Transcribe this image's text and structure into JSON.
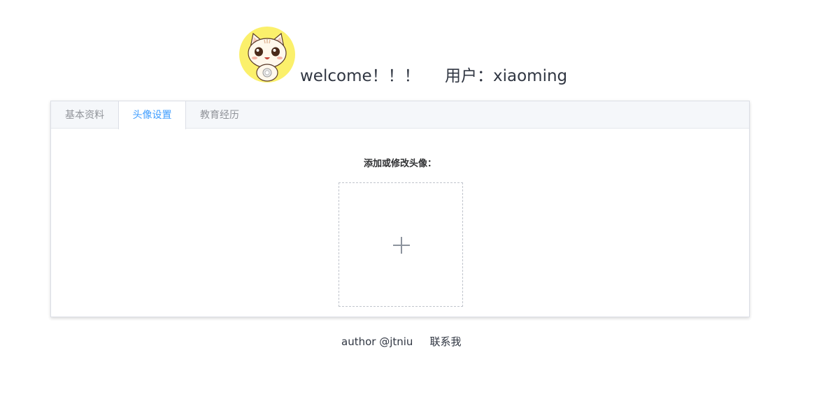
{
  "header": {
    "avatar_icon": "cat-avatar-icon",
    "welcome_text": "welcome！！！",
    "user_text": "用户：xiaoming"
  },
  "tabs": [
    {
      "label": "基本资料",
      "active": false
    },
    {
      "label": "头像设置",
      "active": true
    },
    {
      "label": "教育经历",
      "active": false
    }
  ],
  "avatar_settings": {
    "section_label": "添加或修改头像：",
    "upload_icon": "plus-icon"
  },
  "footer": {
    "author": "author @jtniu",
    "contact": "联系我"
  },
  "colors": {
    "accent": "#409eff",
    "avatar_bg": "#fbf06b",
    "tab_bar_bg": "#f5f7fa"
  }
}
